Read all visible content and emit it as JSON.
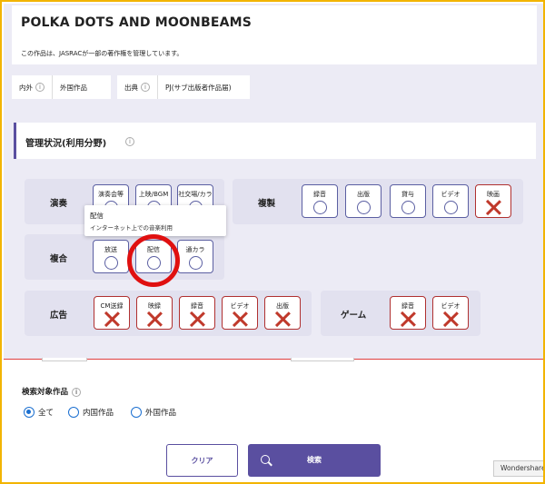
{
  "header": {
    "title": "POLKA DOTS AND MOONBEAMS",
    "notice": "この作品は、JASRACが一部の著作権を管理しています。"
  },
  "info": {
    "origin_label": "内外",
    "origin_value": "外国作品",
    "source_label": "出典",
    "source_value": "PJ(サブ出版者作品届)"
  },
  "management": {
    "title": "管理状況(利用分野)"
  },
  "groups": {
    "performance": {
      "label": "演奏",
      "tiles": [
        "演奏会等",
        "上映/BGM",
        "社交場/カラ"
      ]
    },
    "reproduction": {
      "label": "複製",
      "tiles": [
        "録音",
        "出版",
        "貸与",
        "ビデオ",
        "映画"
      ]
    },
    "composite": {
      "label": "複合",
      "tiles": [
        "放送",
        "配信",
        "通カラ"
      ]
    },
    "ads": {
      "label": "広告",
      "tiles": [
        "CM送録",
        "映録",
        "録音",
        "ビデオ",
        "出版"
      ]
    },
    "game": {
      "label": "ゲーム",
      "tiles": [
        "録音",
        "ビデオ"
      ]
    }
  },
  "tooltip": {
    "title": "配信",
    "desc": "インターネット上での音楽利用"
  },
  "search": {
    "label": "検索対象作品",
    "options": [
      "全て",
      "内国作品",
      "外国作品"
    ],
    "selected": "全て"
  },
  "buttons": {
    "clear": "クリア",
    "search": "検索"
  },
  "watermark": "Wondershare",
  "colors": {
    "accent": "#5a4fa0",
    "ok": "#5b5fa2",
    "ng": "#c0392b",
    "highlight_ring": "#e01010",
    "frame": "#f2b400"
  }
}
